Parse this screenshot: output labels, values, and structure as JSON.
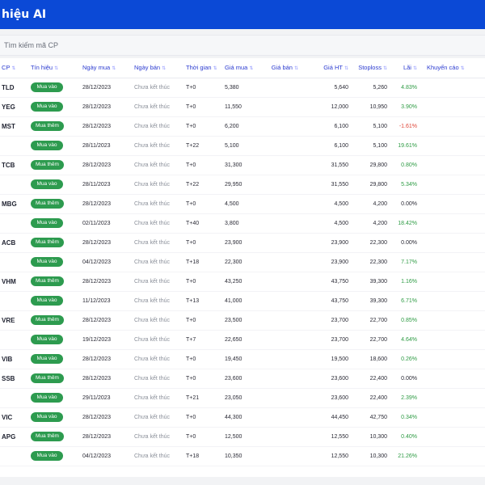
{
  "header": {
    "title": "hiệu AI"
  },
  "search": {
    "placeholder": "Tìm kiếm mã CP"
  },
  "columns": {
    "symbol": "CP",
    "signal": "Tín hiệu",
    "buy_date": "Ngày mua",
    "sell_date": "Ngày bán",
    "time": "Thời gian",
    "buy_price": "Giá mua",
    "sell_price": "Giá bán",
    "current_price": "Giá HT",
    "stoploss": "Stoploss",
    "profit": "Lãi",
    "recommendation": "Khuyến cáo"
  },
  "colors": {
    "header_bg": "#0b49d6",
    "pill_green": "#2d9b4f",
    "positive": "#2e9b44",
    "negative": "#e0473a",
    "column_header_text": "#2b3bd0"
  },
  "rows": [
    {
      "symbol": "TLD",
      "signal": "Mua vào",
      "buy_date": "28/12/2023",
      "sell_date": "Chưa kết thúc",
      "time": "T+0",
      "buy_price": "5,380",
      "sell_price": "",
      "current_price": "5,640",
      "stoploss": "5,260",
      "profit": "4.83%",
      "trend": "pos"
    },
    {
      "symbol": "YEG",
      "signal": "Mua vào",
      "buy_date": "28/12/2023",
      "sell_date": "Chưa kết thúc",
      "time": "T+0",
      "buy_price": "11,550",
      "sell_price": "",
      "current_price": "12,000",
      "stoploss": "10,950",
      "profit": "3.90%",
      "trend": "pos"
    },
    {
      "symbol": "MST",
      "signal": "Mua thêm",
      "buy_date": "28/12/2023",
      "sell_date": "Chưa kết thúc",
      "time": "T+0",
      "buy_price": "6,200",
      "sell_price": "",
      "current_price": "6,100",
      "stoploss": "5,100",
      "profit": "-1.61%",
      "trend": "neg"
    },
    {
      "symbol": "",
      "signal": "Mua vào",
      "buy_date": "28/11/2023",
      "sell_date": "Chưa kết thúc",
      "time": "T+22",
      "buy_price": "5,100",
      "sell_price": "",
      "current_price": "6,100",
      "stoploss": "5,100",
      "profit": "19.61%",
      "trend": "pos"
    },
    {
      "symbol": "TCB",
      "signal": "Mua thêm",
      "buy_date": "28/12/2023",
      "sell_date": "Chưa kết thúc",
      "time": "T+0",
      "buy_price": "31,300",
      "sell_price": "",
      "current_price": "31,550",
      "stoploss": "29,800",
      "profit": "0.80%",
      "trend": "pos"
    },
    {
      "symbol": "",
      "signal": "Mua vào",
      "buy_date": "28/11/2023",
      "sell_date": "Chưa kết thúc",
      "time": "T+22",
      "buy_price": "29,950",
      "sell_price": "",
      "current_price": "31,550",
      "stoploss": "29,800",
      "profit": "5.34%",
      "trend": "pos"
    },
    {
      "symbol": "MBG",
      "signal": "Mua thêm",
      "buy_date": "28/12/2023",
      "sell_date": "Chưa kết thúc",
      "time": "T+0",
      "buy_price": "4,500",
      "sell_price": "",
      "current_price": "4,500",
      "stoploss": "4,200",
      "profit": "0.00%",
      "trend": "neu"
    },
    {
      "symbol": "",
      "signal": "Mua vào",
      "buy_date": "02/11/2023",
      "sell_date": "Chưa kết thúc",
      "time": "T+40",
      "buy_price": "3,800",
      "sell_price": "",
      "current_price": "4,500",
      "stoploss": "4,200",
      "profit": "18.42%",
      "trend": "pos"
    },
    {
      "symbol": "ACB",
      "signal": "Mua thêm",
      "buy_date": "28/12/2023",
      "sell_date": "Chưa kết thúc",
      "time": "T+0",
      "buy_price": "23,900",
      "sell_price": "",
      "current_price": "23,900",
      "stoploss": "22,300",
      "profit": "0.00%",
      "trend": "neu"
    },
    {
      "symbol": "",
      "signal": "Mua vào",
      "buy_date": "04/12/2023",
      "sell_date": "Chưa kết thúc",
      "time": "T+18",
      "buy_price": "22,300",
      "sell_price": "",
      "current_price": "23,900",
      "stoploss": "22,300",
      "profit": "7.17%",
      "trend": "pos"
    },
    {
      "symbol": "VHM",
      "signal": "Mua thêm",
      "buy_date": "28/12/2023",
      "sell_date": "Chưa kết thúc",
      "time": "T+0",
      "buy_price": "43,250",
      "sell_price": "",
      "current_price": "43,750",
      "stoploss": "39,300",
      "profit": "1.16%",
      "trend": "pos"
    },
    {
      "symbol": "",
      "signal": "Mua vào",
      "buy_date": "11/12/2023",
      "sell_date": "Chưa kết thúc",
      "time": "T+13",
      "buy_price": "41,000",
      "sell_price": "",
      "current_price": "43,750",
      "stoploss": "39,300",
      "profit": "6.71%",
      "trend": "pos"
    },
    {
      "symbol": "VRE",
      "signal": "Mua thêm",
      "buy_date": "28/12/2023",
      "sell_date": "Chưa kết thúc",
      "time": "T+0",
      "buy_price": "23,500",
      "sell_price": "",
      "current_price": "23,700",
      "stoploss": "22,700",
      "profit": "0.85%",
      "trend": "pos"
    },
    {
      "symbol": "",
      "signal": "Mua vào",
      "buy_date": "19/12/2023",
      "sell_date": "Chưa kết thúc",
      "time": "T+7",
      "buy_price": "22,650",
      "sell_price": "",
      "current_price": "23,700",
      "stoploss": "22,700",
      "profit": "4.64%",
      "trend": "pos"
    },
    {
      "symbol": "VIB",
      "signal": "Mua vào",
      "buy_date": "28/12/2023",
      "sell_date": "Chưa kết thúc",
      "time": "T+0",
      "buy_price": "19,450",
      "sell_price": "",
      "current_price": "19,500",
      "stoploss": "18,600",
      "profit": "0.26%",
      "trend": "pos"
    },
    {
      "symbol": "SSB",
      "signal": "Mua thêm",
      "buy_date": "28/12/2023",
      "sell_date": "Chưa kết thúc",
      "time": "T+0",
      "buy_price": "23,600",
      "sell_price": "",
      "current_price": "23,600",
      "stoploss": "22,400",
      "profit": "0.00%",
      "trend": "neu"
    },
    {
      "symbol": "",
      "signal": "Mua vào",
      "buy_date": "29/11/2023",
      "sell_date": "Chưa kết thúc",
      "time": "T+21",
      "buy_price": "23,050",
      "sell_price": "",
      "current_price": "23,600",
      "stoploss": "22,400",
      "profit": "2.39%",
      "trend": "pos"
    },
    {
      "symbol": "VIC",
      "signal": "Mua vào",
      "buy_date": "28/12/2023",
      "sell_date": "Chưa kết thúc",
      "time": "T+0",
      "buy_price": "44,300",
      "sell_price": "",
      "current_price": "44,450",
      "stoploss": "42,750",
      "profit": "0.34%",
      "trend": "pos"
    },
    {
      "symbol": "APG",
      "signal": "Mua thêm",
      "buy_date": "28/12/2023",
      "sell_date": "Chưa kết thúc",
      "time": "T+0",
      "buy_price": "12,500",
      "sell_price": "",
      "current_price": "12,550",
      "stoploss": "10,300",
      "profit": "0.40%",
      "trend": "pos"
    },
    {
      "symbol": "",
      "signal": "Mua vào",
      "buy_date": "04/12/2023",
      "sell_date": "Chưa kết thúc",
      "time": "T+18",
      "buy_price": "10,350",
      "sell_price": "",
      "current_price": "12,550",
      "stoploss": "10,300",
      "profit": "21.26%",
      "trend": "pos"
    }
  ]
}
